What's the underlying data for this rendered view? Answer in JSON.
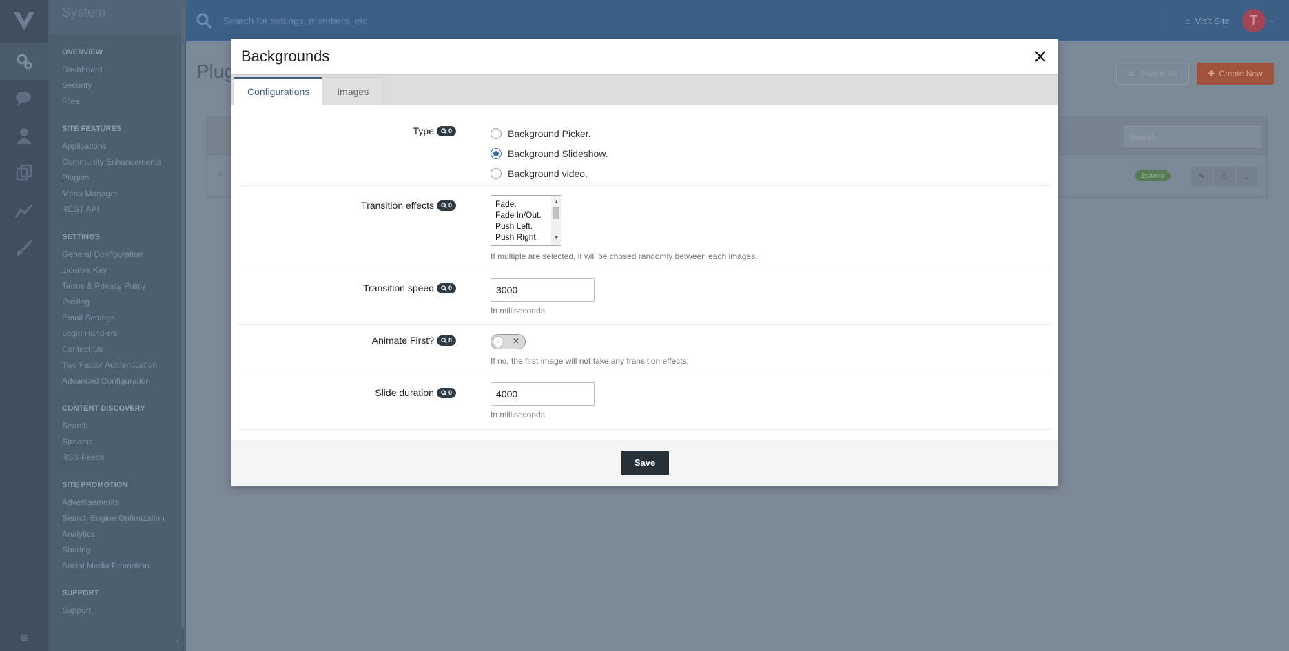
{
  "sidebar": {
    "section_title": "System",
    "groups": [
      {
        "title": "Overview",
        "items": [
          "Dashboard",
          "Security",
          "Files"
        ]
      },
      {
        "title": "Site Features",
        "items": [
          "Applications",
          "Community Enhancements",
          "Plugins",
          "Menu Manager",
          "REST API"
        ]
      },
      {
        "title": "Settings",
        "items": [
          "General Configuration",
          "License Key",
          "Terms & Privacy Policy",
          "Posting",
          "Email Settings",
          "Login Handlers",
          "Contact Us",
          "Two Factor Authentication",
          "Advanced Configuration"
        ]
      },
      {
        "title": "Content Discovery",
        "items": [
          "Search",
          "Streams",
          "RSS Feeds"
        ]
      },
      {
        "title": "Site Promotion",
        "items": [
          "Advertisements",
          "Search Engine Optimization",
          "Analytics",
          "Sharing",
          "Social Media Promotion"
        ]
      },
      {
        "title": "Support",
        "items": [
          "Support"
        ]
      }
    ]
  },
  "topbar": {
    "search_placeholder": "Search for settings, members, etc.",
    "visit_site": "Visit Site",
    "avatar_letter": "T"
  },
  "page": {
    "title": "Plug",
    "disable_all": "Disable All",
    "create_new": "Create New",
    "table_search": "Search...",
    "enabled_badge": "Enabled"
  },
  "modal": {
    "title": "Backgrounds",
    "tabs": [
      "Configurations",
      "Images"
    ],
    "fields": {
      "type": {
        "label": "Type",
        "badge": "0",
        "options": [
          "Background Picker.",
          "Background Slideshow.",
          "Background video."
        ],
        "selected_index": 1
      },
      "transition_effects": {
        "label": "Transition effects",
        "badge": "0",
        "options": [
          "Fade.",
          "Fade In/Out.",
          "Push Left.",
          "Push Right.",
          "Push Up."
        ],
        "help": "If multiple are selected, it will be chosed randomly between each images."
      },
      "transition_speed": {
        "label": "Transition speed",
        "badge": "0",
        "value": "3000",
        "help": "In milliseconds"
      },
      "animate_first": {
        "label": "Animate First?",
        "badge": "0",
        "enabled": false,
        "help": "If no, the first image will not take any transition effects."
      },
      "slide_duration": {
        "label": "Slide duration",
        "badge": "0",
        "value": "4000",
        "help": "In milliseconds"
      }
    },
    "save": "Save"
  }
}
